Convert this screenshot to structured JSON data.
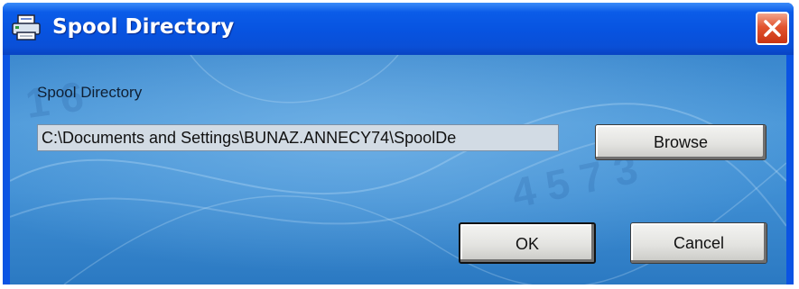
{
  "window": {
    "title": "Spool Directory",
    "icon": "printer-icon",
    "close_icon": "close-icon",
    "accent": "#0b54e3",
    "close_color": "#e2542f"
  },
  "form": {
    "label": "Spool Directory",
    "path_value": "C:\\Documents and Settings\\BUNAZ.ANNECY74\\SpoolDe",
    "browse_label": "Browse",
    "ok_label": "OK",
    "cancel_label": "Cancel"
  }
}
